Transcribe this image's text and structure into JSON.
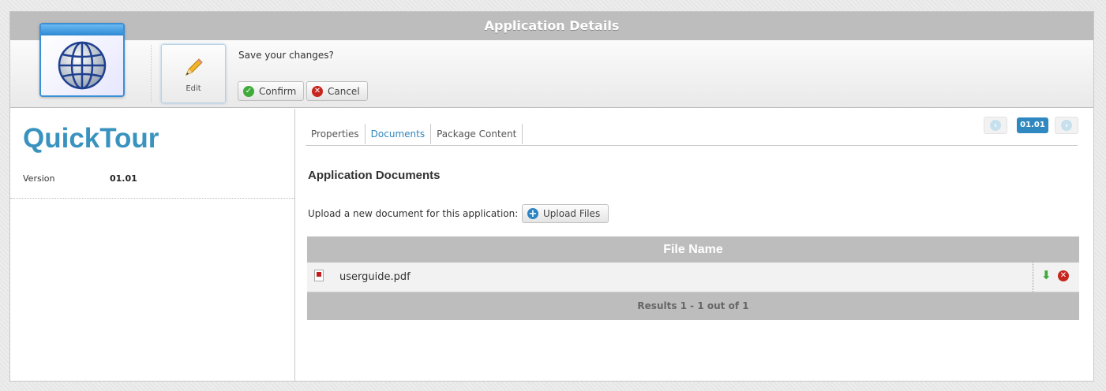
{
  "window": {
    "title": "Application Details"
  },
  "toolbar": {
    "edit_label": "Edit",
    "save_prompt": "Save your changes?",
    "confirm_label": "Confirm",
    "cancel_label": "Cancel"
  },
  "app": {
    "name": "QuickTour",
    "version_label": "Version",
    "version_value": "01.01"
  },
  "tabs": [
    {
      "label": "Properties",
      "active": false
    },
    {
      "label": "Documents",
      "active": true
    },
    {
      "label": "Package Content",
      "active": false
    }
  ],
  "version_nav": {
    "current": "01.01"
  },
  "documents": {
    "title": "Application Documents",
    "upload_text": "Upload a new document for this application:",
    "upload_label": "Upload Files",
    "column_header": "File Name",
    "files": [
      {
        "name": "userguide.pdf",
        "icon": "pdf-icon"
      }
    ],
    "footer": "Results 1 - 1 out of 1"
  },
  "colors": {
    "accent": "#3a93bf",
    "header_gray": "#bdbdbd",
    "badge_blue": "#2f89c0"
  }
}
